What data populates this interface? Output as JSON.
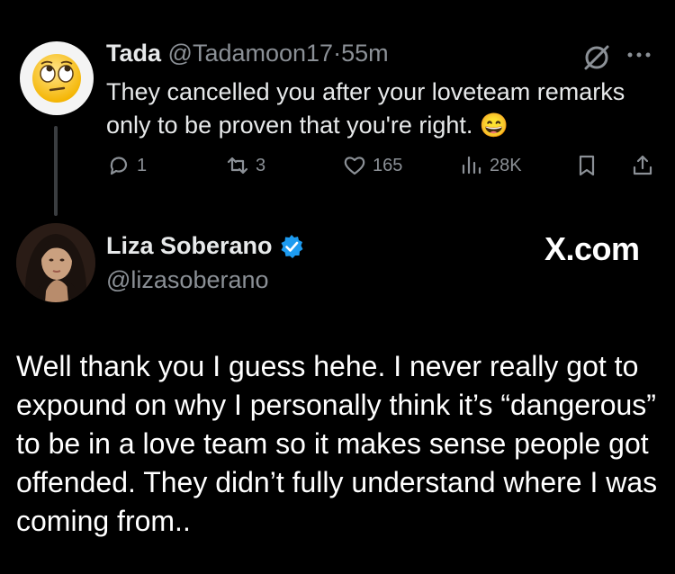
{
  "reply_tweet": {
    "author_name": "Tada",
    "author_handle": "@Tadamoon17",
    "separator": "·",
    "time_ago": "55m",
    "text": "They cancelled you after your loveteam remarks only to be proven that you're right.",
    "emoji": "😄",
    "avatar": "face-with-rolling-eyes",
    "actions": {
      "replies": "1",
      "reposts": "3",
      "likes": "165",
      "views": "28K"
    }
  },
  "main_tweet": {
    "author_name": "Liza Soberano",
    "author_handle": "@lizasoberano",
    "verified": true,
    "watermark": "X.com",
    "text": "Well thank you I guess hehe. I never really got to expound on why I personally think it’s “dangerous” to be in a love team so it makes sense people got offended. They didn’t fully understand where I was coming from.."
  },
  "colors": {
    "background": "#000000",
    "muted": "#8b9096",
    "verified_blue": "#1d9bf0",
    "text": "#e7e9ea"
  }
}
